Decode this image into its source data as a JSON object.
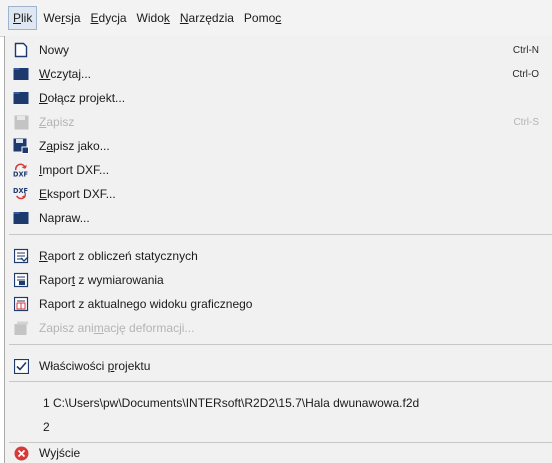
{
  "menubar": [
    {
      "pre": "",
      "key": "P",
      "post": "lik",
      "active": true
    },
    {
      "pre": "We",
      "key": "r",
      "post": "sja",
      "active": false
    },
    {
      "pre": "",
      "key": "E",
      "post": "dycja",
      "active": false
    },
    {
      "pre": "Wido",
      "key": "k",
      "post": "",
      "active": false
    },
    {
      "pre": "",
      "key": "N",
      "post": "arzędzia",
      "active": false
    },
    {
      "pre": "Pomo",
      "key": "c",
      "post": "",
      "active": false
    }
  ],
  "file_menu": {
    "new": {
      "pre": "",
      "key": "",
      "post": "Nowy",
      "shortcut": "Ctrl-N"
    },
    "open": {
      "pre": "",
      "key": "W",
      "post": "czytaj...",
      "shortcut": "Ctrl-O"
    },
    "attach": {
      "pre": "",
      "key": "D",
      "post": "ołącz projekt...",
      "shortcut": ""
    },
    "save": {
      "pre": "",
      "key": "Z",
      "post": "apisz",
      "shortcut": "Ctrl-S",
      "disabled": true
    },
    "save_as": {
      "pre": "Z",
      "key": "a",
      "post": "pisz jako...",
      "shortcut": ""
    },
    "import_dxf": {
      "pre": "",
      "key": "I",
      "post": "mport DXF...",
      "shortcut": ""
    },
    "export_dxf": {
      "pre": "",
      "key": "E",
      "post": "ksport DXF...",
      "shortcut": ""
    },
    "repair": {
      "pre": "",
      "key": "",
      "post": "Napraw...",
      "shortcut": ""
    },
    "report_static": {
      "pre": "",
      "key": "R",
      "post": "aport z obliczeń statycznych"
    },
    "report_dims": {
      "pre": "Rapor",
      "key": "t",
      "post": " z wymiarowania"
    },
    "report_view": {
      "pre": "Raport z aktualnego widoku graficznego",
      "key": "",
      "post": ""
    },
    "save_anim": {
      "pre": "Zapisz ani",
      "key": "m",
      "post": "ację deformacji...",
      "disabled": true
    },
    "properties": {
      "pre": "Właściwości ",
      "key": "p",
      "post": "rojektu"
    },
    "recent_1": "1 C:\\Users\\pw\\Documents\\INTERsoft\\R2D2\\15.7\\Hala dwunawowa.f2d",
    "recent_2": "2",
    "exit": {
      "pre": "Wyjście",
      "key": "",
      "post": ""
    }
  },
  "colors": {
    "menu_bg": "#f1f1f1",
    "menubar_bg": "#f3f3f3",
    "disabled_text": "#b4b4b4",
    "icon_navy": "#1c3a6e",
    "exit_red": "#d83a3a"
  },
  "icons": {
    "new": "document-icon",
    "open": "folder-icon",
    "attach": "folder-icon",
    "save": "save-icon",
    "save_as": "save-as-icon",
    "import_dxf": "dxf-import-icon",
    "export_dxf": "dxf-export-icon",
    "repair": "folder-icon",
    "report_static": "report-icon",
    "report_dims": "report-icon",
    "report_view": "report-icon",
    "save_anim": "animation-icon",
    "properties": "checkbox-icon",
    "exit": "close-icon"
  }
}
